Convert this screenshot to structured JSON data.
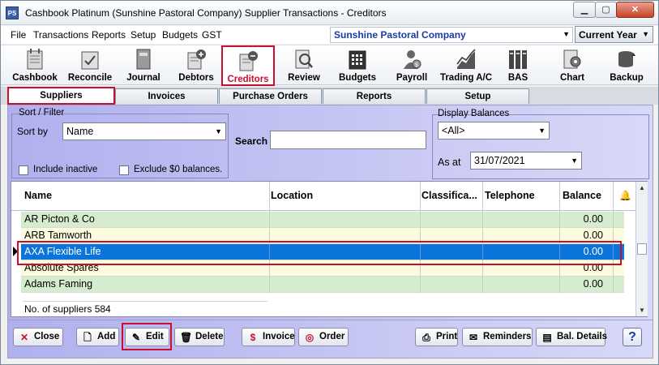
{
  "window": {
    "app_icon": "PS",
    "title": "Cashbook Platinum (Sunshine Pastoral Company)  Supplier Transactions - Creditors",
    "min": "▁",
    "max": "▢",
    "close": "✕"
  },
  "menu": [
    "File",
    "Transactions",
    "Reports",
    "Setup",
    "Budgets",
    "GST"
  ],
  "company": {
    "name": "Sunshine Pastoral Company",
    "arrow": "▼"
  },
  "year": {
    "value": "Current Year",
    "arrow": "▼"
  },
  "toolbar": [
    {
      "label": "Cashbook",
      "icon": "cashbook-icon"
    },
    {
      "label": "Reconcile",
      "icon": "reconcile-icon"
    },
    {
      "label": "Journal",
      "icon": "journal-icon"
    },
    {
      "label": "Debtors",
      "icon": "debtors-icon"
    },
    {
      "label": "Creditors",
      "icon": "creditors-icon"
    },
    {
      "label": "Review",
      "icon": "review-icon"
    },
    {
      "label": "Budgets",
      "icon": "budgets-icon"
    },
    {
      "label": "Payroll",
      "icon": "payroll-icon"
    },
    {
      "label": "Trading A/C",
      "icon": "trading-icon"
    },
    {
      "label": "BAS",
      "icon": "bas-icon"
    },
    {
      "label": "Chart",
      "icon": "chart-icon"
    },
    {
      "label": "Backup",
      "icon": "backup-icon"
    }
  ],
  "tabs": [
    "Suppliers",
    "Invoices",
    "Purchase Orders",
    "Reports",
    "Setup"
  ],
  "sort_filter": {
    "title": "Sort / Filter",
    "sort_by_label": "Sort by",
    "sort_by_value": "Name",
    "include_inactive": "Include inactive",
    "exclude_zero": "Exclude $0 balances."
  },
  "search": {
    "label": "Search",
    "value": ""
  },
  "display_balances": {
    "title": "Display Balances",
    "value": "<All>",
    "as_at_label": "As at",
    "as_at_value": "31/07/2021"
  },
  "grid": {
    "columns": [
      "Name",
      "Location",
      "Classifica...",
      "Telephone",
      "Balance"
    ],
    "bell_icon": "🔔",
    "rows": [
      {
        "name": "AR Picton & Co",
        "location": "",
        "classification": "",
        "telephone": "",
        "balance": "0.00"
      },
      {
        "name": "ARB Tamworth",
        "location": "",
        "classification": "",
        "telephone": "",
        "balance": "0.00"
      },
      {
        "name": "AXA Flexible Life",
        "location": "",
        "classification": "",
        "telephone": "",
        "balance": "0.00"
      },
      {
        "name": "Absolute Spares",
        "location": "",
        "classification": "",
        "telephone": "",
        "balance": "0.00"
      },
      {
        "name": "Adams Faming",
        "location": "",
        "classification": "",
        "telephone": "",
        "balance": "0.00"
      }
    ],
    "footer": "No. of suppliers 584"
  },
  "buttons": {
    "close": "Close",
    "add": "Add",
    "edit": "Edit",
    "delete": "Delete",
    "invoice": "Invoice",
    "order": "Order",
    "print": "Print",
    "reminders": "Reminders",
    "bal_details": "Bal. Details",
    "help": "?"
  },
  "colors": {
    "accent_red": "#c8102e",
    "selection_blue": "#0a74da",
    "company_blue": "#1a3aa8"
  }
}
